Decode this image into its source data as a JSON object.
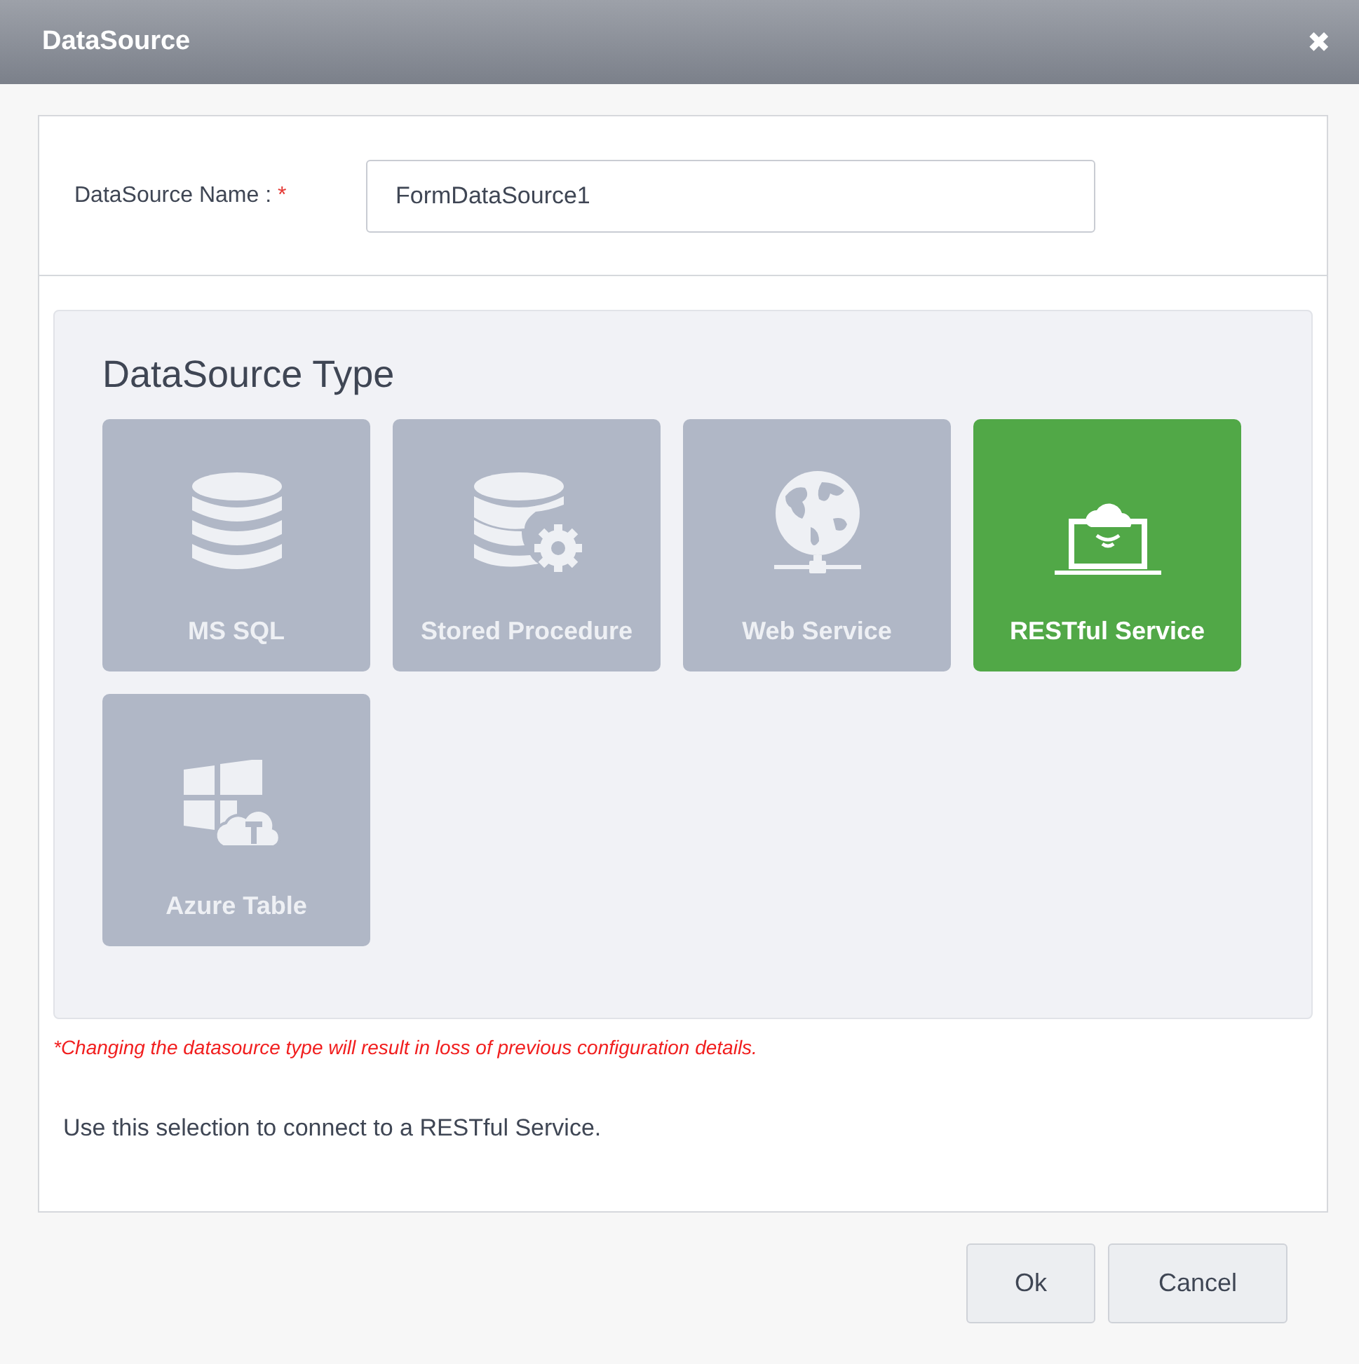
{
  "window": {
    "title": "DataSource",
    "close": "✖"
  },
  "name_field": {
    "label": "DataSource Name :",
    "required_mark": "*",
    "value": "FormDataSource1"
  },
  "type_panel": {
    "title": "DataSource Type",
    "tiles": [
      {
        "label": "MS SQL",
        "kind": "database",
        "selected": false
      },
      {
        "label": "Stored Procedure",
        "kind": "stored-procedure",
        "selected": false
      },
      {
        "label": "Web Service",
        "kind": "globe",
        "selected": false
      },
      {
        "label": "RESTful Service",
        "kind": "cloud-laptop",
        "selected": true
      },
      {
        "label": "Azure Table",
        "kind": "azure-table",
        "selected": false
      }
    ]
  },
  "warning": "*Changing the datasource type will result in loss of previous configuration details.",
  "description": "Use this selection to connect to a RESTful Service.",
  "buttons": [
    "Ok",
    "Cancel"
  ]
}
